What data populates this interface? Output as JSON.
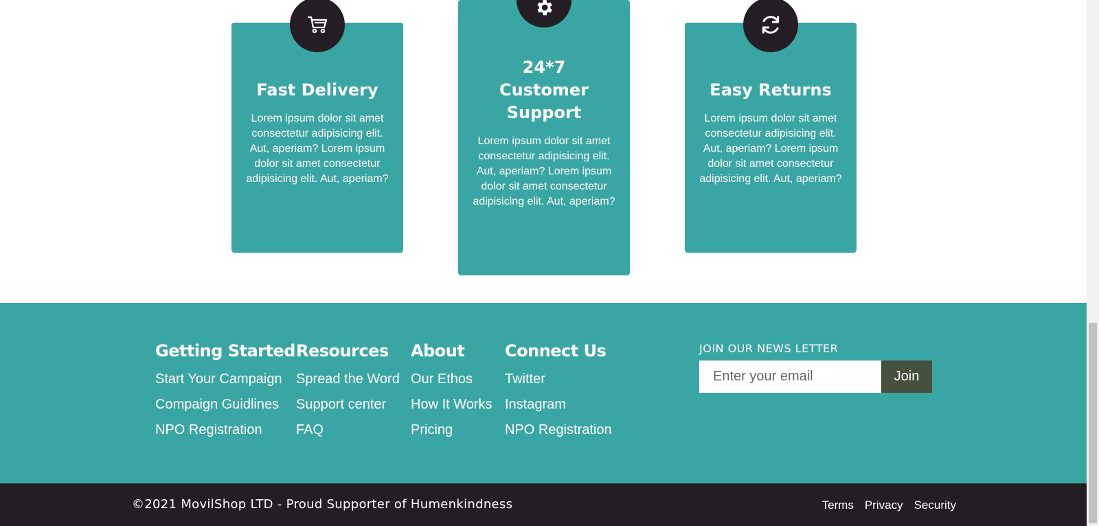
{
  "features": [
    {
      "icon": "cart-icon",
      "title": "Fast Delivery",
      "text": "Lorem ipsum dolor sit amet consectetur adipisicing elit. Aut, aperiam? Lorem ipsum dolor sit amet consectetur adipisicing elit. Aut, aperiam?"
    },
    {
      "icon": "gear-icon",
      "title": "24*7 Customer Support",
      "text": "Lorem ipsum dolor sit amet consectetur adipisicing elit. Aut, aperiam? Lorem ipsum dolor sit amet consectetur adipisicing elit. Aut, aperiam?"
    },
    {
      "icon": "refresh-icon",
      "title": "Easy Returns",
      "text": "Lorem ipsum dolor sit amet consectetur adipisicing elit. Aut, aperiam? Lorem ipsum dolor sit amet consectetur adipisicing elit. Aut, aperiam?"
    }
  ],
  "footer": {
    "columns": [
      {
        "heading": "Getting Started",
        "links": [
          "Start Your Campaign",
          "Compaign Guidlines",
          "NPO Registration"
        ]
      },
      {
        "heading": "Resources",
        "links": [
          "Spread the Word",
          "Support center",
          "FAQ"
        ]
      },
      {
        "heading": "About",
        "links": [
          "Our Ethos",
          "How It Works",
          "Pricing"
        ]
      },
      {
        "heading": "Connect Us",
        "links": [
          "Twitter",
          "Instagram",
          "NPO Registration"
        ]
      }
    ],
    "newsletter": {
      "label": "JOIN OUR NEWS LETTER",
      "placeholder": "Enter your email",
      "button": "Join"
    }
  },
  "bottom_bar": {
    "copyright": "©2021 MovilShop LTD - Proud Supporter of Humenkindness",
    "links": [
      "Terms",
      "Privacy",
      "Security"
    ]
  },
  "colors": {
    "teal": "#3aa6a4",
    "dark": "#221e24",
    "join_button": "#46503f"
  }
}
